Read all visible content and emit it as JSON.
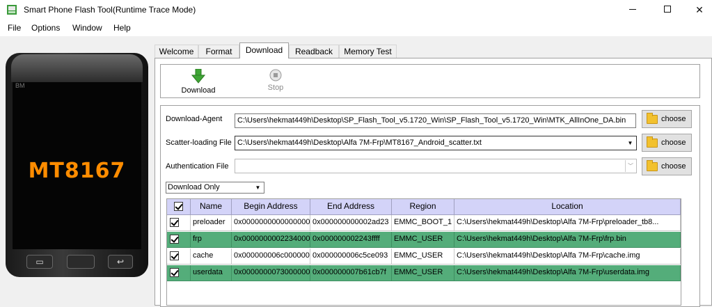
{
  "window": {
    "title": "Smart Phone Flash Tool(Runtime Trace Mode)",
    "controls": {
      "minimize": "–",
      "maximize": "☐",
      "close": "✕"
    }
  },
  "menu": [
    "File",
    "Options",
    "Window",
    "Help"
  ],
  "phone": {
    "brand_text": "BM",
    "chip": "MT8167"
  },
  "tabs": [
    {
      "label": "Welcome",
      "active": false
    },
    {
      "label": "Format",
      "active": false
    },
    {
      "label": "Download",
      "active": true
    },
    {
      "label": "Readback",
      "active": false
    },
    {
      "label": "Memory Test",
      "active": false
    }
  ],
  "toolbar": {
    "download_label": "Download",
    "stop_label": "Stop"
  },
  "form": {
    "download_agent_label": "Download-Agent",
    "download_agent_value": "C:\\Users\\hekmat449h\\Desktop\\SP_Flash_Tool_v5.1720_Win\\SP_Flash_Tool_v5.1720_Win\\MTK_AllInOne_DA.bin",
    "scatter_label": "Scatter-loading File",
    "scatter_value": "C:\\Users\\hekmat449h\\Desktop\\Alfa 7M-Frp\\MT8167_Android_scatter.txt",
    "auth_label": "Authentication File",
    "auth_value": "",
    "choose_label": "choose",
    "mode_value": "Download Only"
  },
  "table": {
    "headers": [
      "Name",
      "Begin Address",
      "End Address",
      "Region",
      "Location"
    ],
    "rows": [
      {
        "checked": true,
        "highlight": false,
        "name": "preloader",
        "begin": "0x0000000000000000",
        "end": "0x000000000002ad23",
        "region": "EMMC_BOOT_1",
        "location": "C:\\Users\\hekmat449h\\Desktop\\Alfa 7M-Frp\\preloader_tb8..."
      },
      {
        "checked": true,
        "highlight": true,
        "name": "frp",
        "begin": "0x0000000002234000",
        "end": "0x000000002243ffff",
        "region": "EMMC_USER",
        "location": "C:\\Users\\hekmat449h\\Desktop\\Alfa 7M-Frp\\frp.bin"
      },
      {
        "checked": true,
        "highlight": false,
        "name": "cache",
        "begin": "0x000000006c000000",
        "end": "0x000000006c5ce093",
        "region": "EMMC_USER",
        "location": "C:\\Users\\hekmat449h\\Desktop\\Alfa 7M-Frp\\cache.img"
      },
      {
        "checked": true,
        "highlight": true,
        "name": "userdata",
        "begin": "0x0000000073000000",
        "end": "0x000000007b61cb7f",
        "region": "EMMC_USER",
        "location": "C:\\Users\\hekmat449h\\Desktop\\Alfa 7M-Frp\\userdata.img"
      }
    ]
  },
  "colors": {
    "highlight_row": "#54ad7a",
    "table_header": "#d3d3f8",
    "chip_text": "#ff8c00",
    "download_icon": "#3fa535"
  }
}
